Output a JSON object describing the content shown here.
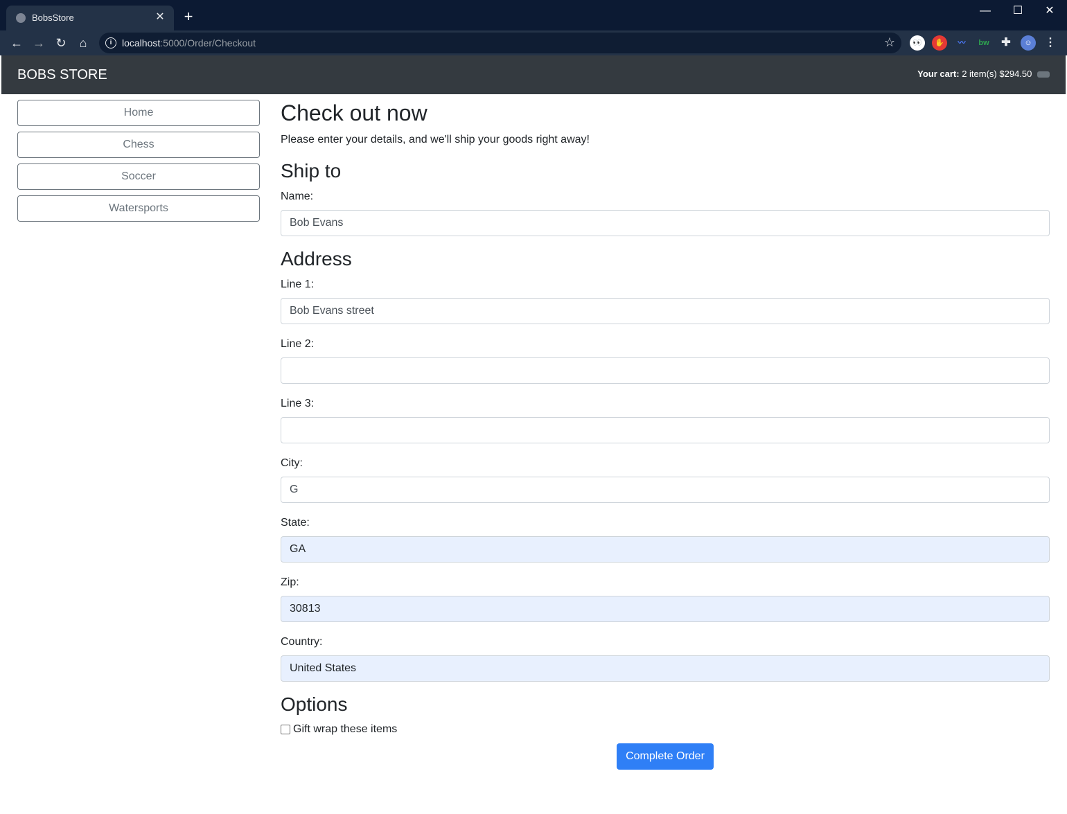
{
  "browser": {
    "tab_title": "BobsStore",
    "url_host": "localhost",
    "url_rest": ":5000/Order/Checkout"
  },
  "site": {
    "brand": "BOBS STORE",
    "cart_label": "Your cart:",
    "cart_summary": "2 item(s) $294.50"
  },
  "sidebar": {
    "items": [
      {
        "label": "Home"
      },
      {
        "label": "Chess"
      },
      {
        "label": "Soccer"
      },
      {
        "label": "Watersports"
      }
    ]
  },
  "main": {
    "title": "Check out now",
    "lead": "Please enter your details, and we'll ship your goods right away!",
    "ship_heading": "Ship to",
    "name_label": "Name:",
    "name_value": "Bob Evans",
    "address_heading": "Address",
    "line1_label": "Line 1:",
    "line1_value": "Bob Evans street",
    "line2_label": "Line 2:",
    "line2_value": "",
    "line3_label": "Line 3:",
    "line3_value": "",
    "city_label": "City:",
    "city_value": "G",
    "state_label": "State:",
    "state_value": "GA",
    "zip_label": "Zip:",
    "zip_value": "30813",
    "country_label": "Country:",
    "country_value": "United States",
    "options_heading": "Options",
    "giftwrap_label": "Gift wrap these items",
    "giftwrap_checked": false,
    "submit_label": "Complete Order"
  },
  "colors": {
    "navbar": "#343a40",
    "primary": "#2f7ff6",
    "autofill": "#e8f0fe"
  }
}
